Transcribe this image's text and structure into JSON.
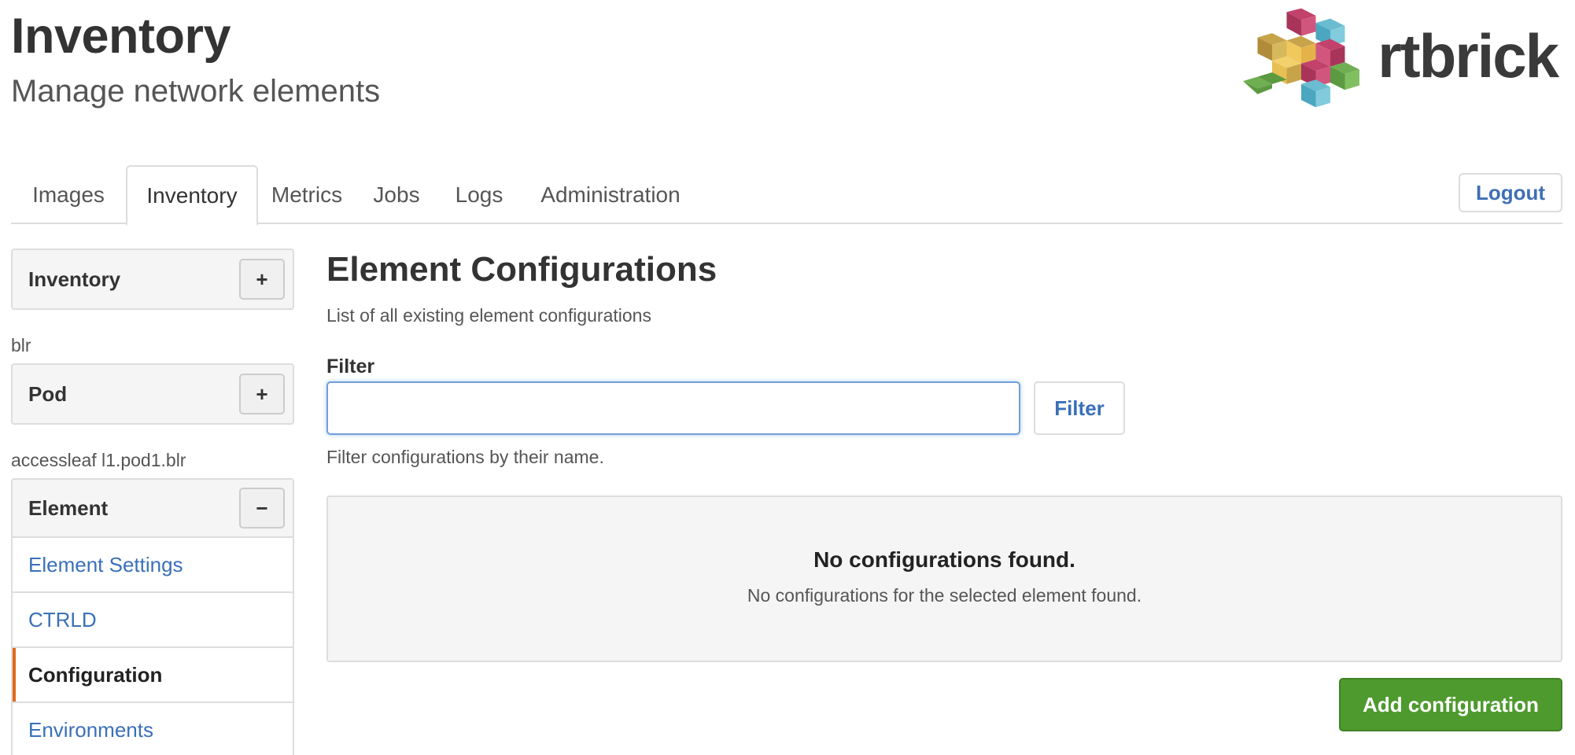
{
  "header": {
    "title": "Inventory",
    "subtitle": "Manage network elements",
    "logo_text": "rtbrick",
    "logo_icon": "rtbrick-cubes-logo"
  },
  "nav": {
    "tabs": [
      {
        "label": "Images",
        "active": false
      },
      {
        "label": "Inventory",
        "active": true
      },
      {
        "label": "Metrics",
        "active": false
      },
      {
        "label": "Jobs",
        "active": false
      },
      {
        "label": "Logs",
        "active": false
      },
      {
        "label": "Administration",
        "active": false
      }
    ],
    "logout_label": "Logout"
  },
  "sidebar": {
    "inventory_panel": {
      "title": "Inventory",
      "button": "+"
    },
    "pod_crumb": "blr",
    "pod_panel": {
      "title": "Pod",
      "button": "+"
    },
    "element_crumb": "accessleaf l1.pod1.blr",
    "element_panel": {
      "title": "Element",
      "button": "−",
      "items": [
        {
          "label": "Element Settings",
          "active": false
        },
        {
          "label": "CTRLD",
          "active": false
        },
        {
          "label": "Configuration",
          "active": true
        },
        {
          "label": "Environments",
          "active": false
        }
      ]
    }
  },
  "main": {
    "title": "Element Configurations",
    "description": "List of all existing element configurations",
    "filter_label": "Filter",
    "filter_value": "",
    "filter_placeholder": "",
    "filter_button": "Filter",
    "filter_help": "Filter configurations by their name.",
    "empty_title": "No configurations found.",
    "empty_desc": "No configurations for the selected element found.",
    "add_button": "Add configuration"
  },
  "colors": {
    "link": "#3a70b8",
    "active_marker": "#e06a1a",
    "add_button": "#4e9a2e"
  }
}
